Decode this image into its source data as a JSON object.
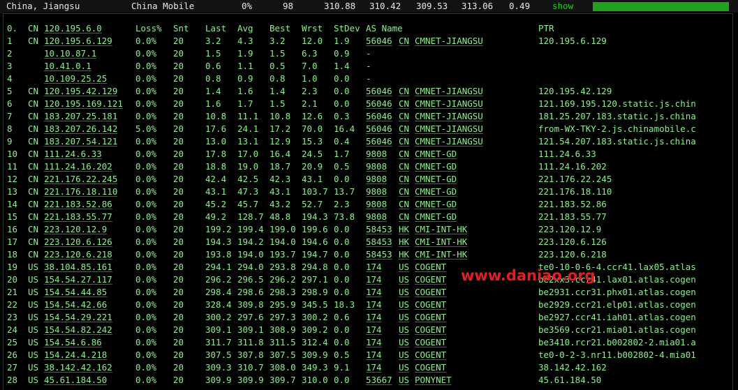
{
  "summary": {
    "location": "China, Jiangsu",
    "isp": "China Mobile",
    "loss": "0%",
    "sent": "98",
    "avg": "310.88",
    "best": "310.42",
    "last": "309.53",
    "worst": "313.06",
    "stdev": "0.49",
    "show_label": "show",
    "bar_fill": 1.0
  },
  "headers": {
    "hop": "0.",
    "cc": "CN",
    "ip": "120.195.6.0",
    "loss": "Loss%",
    "snt": "Snt",
    "last": "Last",
    "avg": "Avg",
    "best": "Best",
    "wrst": "Wrst",
    "stdev": "StDev",
    "as_name": "AS Name",
    "ptr": "PTR"
  },
  "hops": [
    {
      "hop": "1",
      "cc": "CN",
      "ip": "120.195.6.129",
      "loss": "0.0%",
      "snt": "20",
      "last": "3.2",
      "avg": "4.3",
      "best": "3.2",
      "wrst": "12.0",
      "stdev": "1.9",
      "asn": "56046",
      "as_cc": "CN",
      "as_name": "CMNET-JIANGSU",
      "ptr": "120.195.6.129"
    },
    {
      "hop": "2",
      "cc": "",
      "ip": "10.10.87.1",
      "loss": "0.0%",
      "snt": "20",
      "last": "1.5",
      "avg": "1.9",
      "best": "1.5",
      "wrst": "6.3",
      "stdev": "0.9",
      "asn": "-",
      "as_cc": "",
      "as_name": "",
      "ptr": ""
    },
    {
      "hop": "3",
      "cc": "",
      "ip": "10.41.0.1",
      "loss": "0.0%",
      "snt": "20",
      "last": "0.6",
      "avg": "1.1",
      "best": "0.5",
      "wrst": "7.0",
      "stdev": "1.4",
      "asn": "-",
      "as_cc": "",
      "as_name": "",
      "ptr": ""
    },
    {
      "hop": "4",
      "cc": "",
      "ip": "10.109.25.25",
      "loss": "0.0%",
      "snt": "20",
      "last": "0.8",
      "avg": "0.9",
      "best": "0.8",
      "wrst": "1.0",
      "stdev": "0.0",
      "asn": "-",
      "as_cc": "",
      "as_name": "",
      "ptr": ""
    },
    {
      "hop": "5",
      "cc": "CN",
      "ip": "120.195.42.129",
      "loss": "0.0%",
      "snt": "20",
      "last": "1.4",
      "avg": "1.6",
      "best": "1.4",
      "wrst": "2.3",
      "stdev": "0.0",
      "asn": "56046",
      "as_cc": "CN",
      "as_name": "CMNET-JIANGSU",
      "ptr": "120.195.42.129"
    },
    {
      "hop": "6",
      "cc": "CN",
      "ip": "120.195.169.121",
      "loss": "0.0%",
      "snt": "20",
      "last": "1.6",
      "avg": "1.7",
      "best": "1.5",
      "wrst": "2.1",
      "stdev": "0.0",
      "asn": "56046",
      "as_cc": "CN",
      "as_name": "CMNET-JIANGSU",
      "ptr": "121.169.195.120.static.js.chin"
    },
    {
      "hop": "7",
      "cc": "CN",
      "ip": "183.207.25.181",
      "loss": "0.0%",
      "snt": "20",
      "last": "10.8",
      "avg": "11.1",
      "best": "10.8",
      "wrst": "12.6",
      "stdev": "0.3",
      "asn": "56046",
      "as_cc": "CN",
      "as_name": "CMNET-JIANGSU",
      "ptr": "181.25.207.183.static.js.china"
    },
    {
      "hop": "8",
      "cc": "CN",
      "ip": "183.207.26.142",
      "loss": "5.0%",
      "snt": "20",
      "last": "17.6",
      "avg": "24.1",
      "best": "17.2",
      "wrst": "70.0",
      "stdev": "16.4",
      "asn": "56046",
      "as_cc": "CN",
      "as_name": "CMNET-JIANGSU",
      "ptr": "from-WX-TKY-2.js.chinamobile.c"
    },
    {
      "hop": "9",
      "cc": "CN",
      "ip": "183.207.54.121",
      "loss": "0.0%",
      "snt": "20",
      "last": "13.0",
      "avg": "13.1",
      "best": "12.9",
      "wrst": "15.3",
      "stdev": "0.4",
      "asn": "56046",
      "as_cc": "CN",
      "as_name": "CMNET-JIANGSU",
      "ptr": "121.54.207.183.static.js.china"
    },
    {
      "hop": "10",
      "cc": "CN",
      "ip": "111.24.6.33",
      "loss": "0.0%",
      "snt": "20",
      "last": "17.8",
      "avg": "17.0",
      "best": "16.4",
      "wrst": "24.5",
      "stdev": "1.7",
      "asn": "9808",
      "as_cc": "CN",
      "as_name": "CMNET-GD",
      "ptr": "111.24.6.33"
    },
    {
      "hop": "11",
      "cc": "CN",
      "ip": "111.24.16.202",
      "loss": "0.0%",
      "snt": "20",
      "last": "18.8",
      "avg": "19.0",
      "best": "18.7",
      "wrst": "20.9",
      "stdev": "0.5",
      "asn": "9808",
      "as_cc": "CN",
      "as_name": "CMNET-GD",
      "ptr": "111.24.16.202"
    },
    {
      "hop": "12",
      "cc": "CN",
      "ip": "221.176.22.245",
      "loss": "0.0%",
      "snt": "20",
      "last": "42.4",
      "avg": "42.5",
      "best": "42.3",
      "wrst": "43.1",
      "stdev": "0.0",
      "asn": "9808",
      "as_cc": "CN",
      "as_name": "CMNET-GD",
      "ptr": "221.176.22.245"
    },
    {
      "hop": "13",
      "cc": "CN",
      "ip": "221.176.18.110",
      "loss": "0.0%",
      "snt": "20",
      "last": "43.1",
      "avg": "47.3",
      "best": "43.1",
      "wrst": "103.7",
      "stdev": "13.7",
      "asn": "9808",
      "as_cc": "CN",
      "as_name": "CMNET-GD",
      "ptr": "221.176.18.110"
    },
    {
      "hop": "14",
      "cc": "CN",
      "ip": "221.183.52.86",
      "loss": "0.0%",
      "snt": "20",
      "last": "45.2",
      "avg": "45.7",
      "best": "43.2",
      "wrst": "52.7",
      "stdev": "2.3",
      "asn": "9808",
      "as_cc": "CN",
      "as_name": "CMNET-GD",
      "ptr": "221.183.52.86"
    },
    {
      "hop": "15",
      "cc": "CN",
      "ip": "221.183.55.77",
      "loss": "0.0%",
      "snt": "20",
      "last": "49.2",
      "avg": "128.7",
      "best": "48.8",
      "wrst": "194.3",
      "stdev": "73.8",
      "asn": "9808",
      "as_cc": "CN",
      "as_name": "CMNET-GD",
      "ptr": "221.183.55.77"
    },
    {
      "hop": "16",
      "cc": "CN",
      "ip": "223.120.12.9",
      "loss": "0.0%",
      "snt": "20",
      "last": "199.2",
      "avg": "199.4",
      "best": "199.0",
      "wrst": "199.6",
      "stdev": "0.0",
      "asn": "58453",
      "as_cc": "HK",
      "as_name": "CMI-INT-HK",
      "ptr": "223.120.12.9"
    },
    {
      "hop": "17",
      "cc": "CN",
      "ip": "223.120.6.126",
      "loss": "0.0%",
      "snt": "20",
      "last": "194.3",
      "avg": "194.2",
      "best": "194.0",
      "wrst": "194.6",
      "stdev": "0.0",
      "asn": "58453",
      "as_cc": "HK",
      "as_name": "CMI-INT-HK",
      "ptr": "223.120.6.126"
    },
    {
      "hop": "18",
      "cc": "CN",
      "ip": "223.120.6.218",
      "loss": "0.0%",
      "snt": "20",
      "last": "193.8",
      "avg": "194.0",
      "best": "193.7",
      "wrst": "194.7",
      "stdev": "0.0",
      "asn": "58453",
      "as_cc": "HK",
      "as_name": "CMI-INT-HK",
      "ptr": "223.120.6.218"
    },
    {
      "hop": "19",
      "cc": "US",
      "ip": "38.104.85.161",
      "loss": "0.0%",
      "snt": "20",
      "last": "294.1",
      "avg": "294.0",
      "best": "293.8",
      "wrst": "294.8",
      "stdev": "0.0",
      "asn": "174",
      "as_cc": "US",
      "as_name": "COGENT",
      "ptr": "te0-10-0-6-4.ccr41.lax05.atlas"
    },
    {
      "hop": "20",
      "cc": "US",
      "ip": "154.54.27.117",
      "loss": "0.0%",
      "snt": "20",
      "last": "296.2",
      "avg": "296.5",
      "best": "296.2",
      "wrst": "297.1",
      "stdev": "0.0",
      "asn": "174",
      "as_cc": "US",
      "as_name": "COGENT",
      "ptr": "be2xx3.ccr41.lax01.atlas.cogen"
    },
    {
      "hop": "21",
      "cc": "US",
      "ip": "154.54.44.85",
      "loss": "0.0%",
      "snt": "20",
      "last": "298.4",
      "avg": "298.6",
      "best": "298.3",
      "wrst": "298.9",
      "stdev": "0.0",
      "asn": "174",
      "as_cc": "US",
      "as_name": "COGENT",
      "ptr": "be2931.ccr31.phx01.atlas.cogen"
    },
    {
      "hop": "22",
      "cc": "US",
      "ip": "154.54.42.66",
      "loss": "0.0%",
      "snt": "20",
      "last": "328.4",
      "avg": "309.8",
      "best": "295.9",
      "wrst": "345.5",
      "stdev": "18.3",
      "asn": "174",
      "as_cc": "US",
      "as_name": "COGENT",
      "ptr": "be2929.ccr21.elp01.atlas.cogen"
    },
    {
      "hop": "23",
      "cc": "US",
      "ip": "154.54.29.221",
      "loss": "0.0%",
      "snt": "20",
      "last": "300.2",
      "avg": "297.6",
      "best": "297.3",
      "wrst": "300.2",
      "stdev": "0.6",
      "asn": "174",
      "as_cc": "US",
      "as_name": "COGENT",
      "ptr": "be2927.ccr41.iah01.atlas.cogen"
    },
    {
      "hop": "24",
      "cc": "US",
      "ip": "154.54.82.242",
      "loss": "0.0%",
      "snt": "20",
      "last": "309.1",
      "avg": "309.1",
      "best": "308.9",
      "wrst": "309.2",
      "stdev": "0.0",
      "asn": "174",
      "as_cc": "US",
      "as_name": "COGENT",
      "ptr": "be3569.ccr21.mia01.atlas.cogen"
    },
    {
      "hop": "25",
      "cc": "US",
      "ip": "154.54.6.86",
      "loss": "0.0%",
      "snt": "20",
      "last": "311.7",
      "avg": "311.8",
      "best": "311.5",
      "wrst": "312.4",
      "stdev": "0.0",
      "asn": "174",
      "as_cc": "US",
      "as_name": "COGENT",
      "ptr": "be3410.rcr21.b002802-2.mia01.a"
    },
    {
      "hop": "26",
      "cc": "US",
      "ip": "154.24.4.218",
      "loss": "0.0%",
      "snt": "20",
      "last": "307.5",
      "avg": "307.8",
      "best": "307.5",
      "wrst": "309.9",
      "stdev": "0.5",
      "asn": "174",
      "as_cc": "US",
      "as_name": "COGENT",
      "ptr": "te0-0-2-3.nr11.b002802-4.mia01"
    },
    {
      "hop": "27",
      "cc": "US",
      "ip": "38.142.42.162",
      "loss": "0.0%",
      "snt": "20",
      "last": "309.3",
      "avg": "310.7",
      "best": "308.0",
      "wrst": "349.3",
      "stdev": "9.1",
      "asn": "174",
      "as_cc": "US",
      "as_name": "COGENT",
      "ptr": "38.142.42.162"
    },
    {
      "hop": "28",
      "cc": "US",
      "ip": "45.61.184.50",
      "loss": "0.0%",
      "snt": "20",
      "last": "309.9",
      "avg": "309.9",
      "best": "309.7",
      "wrst": "310.0",
      "stdev": "0.0",
      "asn": "53667",
      "as_cc": "US",
      "as_name": "PONYNET",
      "ptr": "45.61.184.50"
    }
  ],
  "watermark": "www.daniao.org",
  "colors": {
    "text": "#8fef8f",
    "header_text": "#e8e8e8",
    "bar": "#1fa31f",
    "watermark": "#e02020",
    "background": "#000000"
  }
}
